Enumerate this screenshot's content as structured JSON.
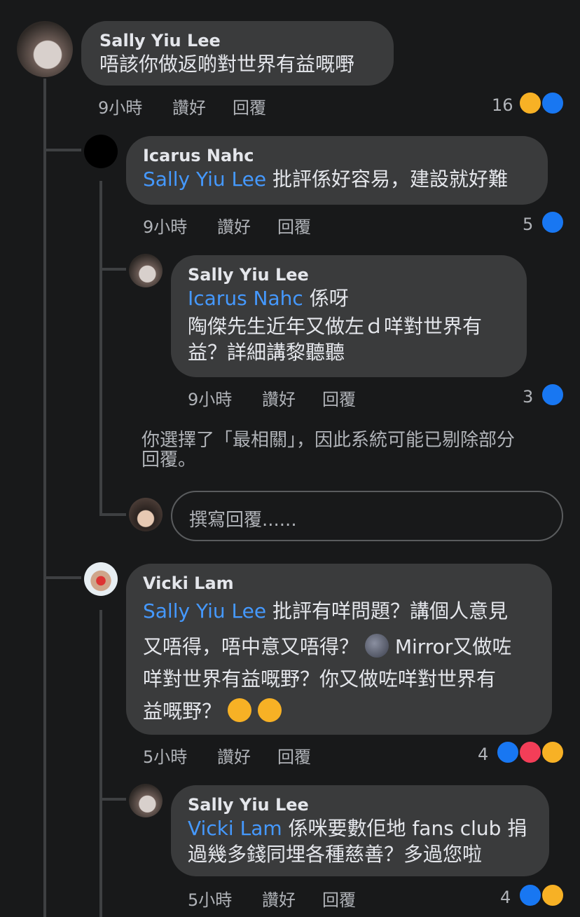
{
  "comments": [
    {
      "author": "Sally Yiu Lee",
      "mention": "",
      "lines": [
        "唔該你做返啲對世界有益嘅嘢"
      ],
      "time": "9小時",
      "like": "讚好",
      "reply": "回覆",
      "count": "16",
      "reactions": [
        "haha",
        "like"
      ]
    },
    {
      "author": "Icarus Nahc",
      "mention": "Sally Yiu Lee",
      "lines": [
        "批評係好容易，建設就好難"
      ],
      "time": "9小時",
      "like": "讚好",
      "reply": "回覆",
      "count": "5",
      "reactions": [
        "like"
      ]
    },
    {
      "author": "Sally Yiu Lee",
      "mention": "Icarus Nahc",
      "lines": [
        "係呀",
        "陶傑先生近年又做左ｄ咩對世界有",
        "益？詳細講黎聽聽"
      ],
      "time": "9小時",
      "like": "讚好",
      "reply": "回覆",
      "count": "3",
      "reactions": [
        "like"
      ]
    },
    {
      "author": "Vicki Lam",
      "mention": "Sally Yiu Lee",
      "lines": [
        "批評有咩問題？講個人意見",
        "又唔得，唔中意又唔得？",
        "Mirror又做咗",
        "咩對世界有益嘅野？你又做咗咩對世界有",
        "益嘅野？"
      ],
      "time": "5小時",
      "like": "讚好",
      "reply": "回覆",
      "count": "4",
      "reactions": [
        "like",
        "love",
        "haha"
      ]
    },
    {
      "author": "Sally Yiu Lee",
      "mention": "Vicki Lam",
      "lines": [
        "係咪要數佢地 fans club 捐",
        "過幾多錢同埋各種慈善？多過您啦"
      ],
      "time": "5小時",
      "like": "讚好",
      "reply": "回覆",
      "count": "4",
      "reactions": [
        "like",
        "haha"
      ]
    }
  ],
  "notice": [
    "你選擇了「最相關」，因此系統可能已剔除部分",
    "回覆。"
  ],
  "reply_placeholder": "撰寫回覆......",
  "colors": {
    "like": "#1877f2",
    "love": "#f33e58",
    "haha": "#f7b125",
    "mention": "#4599ff"
  },
  "icons": {
    "like": "thumbs-up-icon",
    "love": "heart-icon",
    "haha": "laughing-face-icon",
    "moon": "new-moon-face-emoji",
    "rofl": "rolling-laughing-emoji"
  }
}
